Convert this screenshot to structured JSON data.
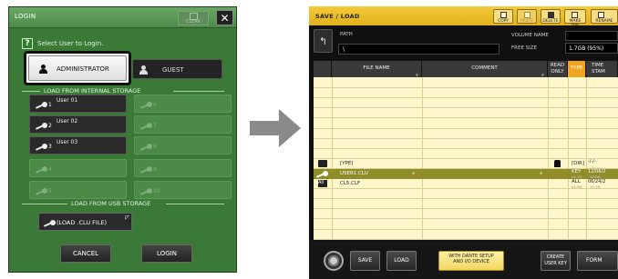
{
  "login": {
    "title": "LOGIN",
    "clear_label": "CLEAR",
    "close_label": "✕",
    "prompt": "Select User to Login.",
    "admin_label": "ADMINISTRATOR",
    "guest_label": "GUEST",
    "internal_heading": "LOAD FROM INTERNAL STORAGE",
    "keys": [
      {
        "num": "1",
        "name": "User 01",
        "enabled": true
      },
      {
        "num": "6",
        "name": "",
        "enabled": false
      },
      {
        "num": "2",
        "name": "User 02",
        "enabled": true
      },
      {
        "num": "7",
        "name": "",
        "enabled": false
      },
      {
        "num": "3",
        "name": "User 03",
        "enabled": true
      },
      {
        "num": "8",
        "name": "",
        "enabled": false
      },
      {
        "num": "4",
        "name": "",
        "enabled": false
      },
      {
        "num": "9",
        "name": "",
        "enabled": false
      },
      {
        "num": "5",
        "name": "",
        "enabled": false
      },
      {
        "num": "10",
        "name": "",
        "enabled": false
      }
    ],
    "usb_heading": "LOAD FROM USB STORAGE",
    "usb_button": "(LOAD .CLU FILE)",
    "cancel_label": "CANCEL",
    "login_label": "LOGIN"
  },
  "saveload": {
    "title": "SAVE / LOAD",
    "toolbar": {
      "copy": "COPY",
      "paste": "PASTE",
      "delete": "DELETE",
      "make_dir": "MAKE DIR",
      "rename": "RENAME"
    },
    "path_label": "PATH",
    "path_value": "\\",
    "volume_label": "VOLUME NAME",
    "freesize_label": "FREE SIZE",
    "freesize_value": "1.7GB (95%)",
    "columns": {
      "file_name": "FILE NAME",
      "comment": "COMMENT",
      "read_only": "READ ONLY",
      "type": "TYPE",
      "time_stamp": "TIME STAM"
    },
    "rows": [
      {
        "name": "[YPE]",
        "type": "[DIR]",
        "lock": true,
        "time": "-/-/-",
        "time2": "--:--:--",
        "ver": "",
        "icon": "folder"
      },
      {
        "name": "USER1.CLU",
        "type": "KEY",
        "ver": "V1.70",
        "time": "12/06/2",
        "time2": "15:09:",
        "lock": false,
        "icon": "key"
      },
      {
        "name": "CL5.CLF",
        "type": "ALL",
        "ver": "V1.50",
        "time": "06/24/2",
        "time2": "17:15:",
        "lock": false,
        "icon": "all"
      }
    ],
    "bottom": {
      "save": "SAVE",
      "load": "LOAD",
      "dante": "WITH DANTE SETUP AND I/O DEVICE",
      "create": "CREATE USER KEY",
      "format": "FORM"
    }
  },
  "colors": {
    "login_bg": "#3a7a36",
    "header_yellow": "#e2b01a",
    "table_bg": "#fff7cc",
    "selected_row": "#8f8c2a",
    "type_orange": "#f0a51e"
  }
}
